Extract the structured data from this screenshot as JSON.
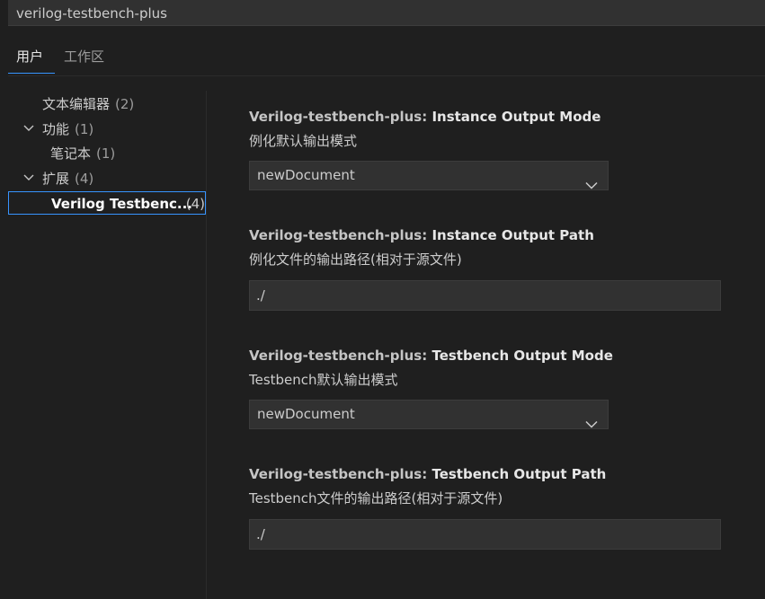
{
  "search": {
    "value": "verilog-testbench-plus"
  },
  "tabs": [
    {
      "label": "用户",
      "active": true
    },
    {
      "label": "工作区",
      "active": false
    }
  ],
  "tree": [
    {
      "label": "文本编辑器",
      "count": "(2)"
    },
    {
      "label": "功能",
      "count": "(1)",
      "expanded": true
    },
    {
      "label": "笔记本",
      "count": "(1)"
    },
    {
      "label": "扩展",
      "count": "(4)",
      "expanded": true
    },
    {
      "label": "Verilog Testbenc...",
      "count": "(4)",
      "selected": true
    }
  ],
  "settings": [
    {
      "prefix": "Verilog-testbench-plus: ",
      "name": "Instance Output Mode",
      "description": "例化默认输出模式",
      "value": "newDocument",
      "control": "select"
    },
    {
      "prefix": "Verilog-testbench-plus: ",
      "name": "Instance Output Path",
      "description": "例化文件的输出路径(相对于源文件)",
      "value": "./",
      "control": "text"
    },
    {
      "prefix": "Verilog-testbench-plus: ",
      "name": "Testbench Output Mode",
      "description": "Testbench默认输出模式",
      "value": "newDocument",
      "control": "select"
    },
    {
      "prefix": "Verilog-testbench-plus: ",
      "name": "Testbench Output Path",
      "description": "Testbench文件的输出路径(相对于源文件)",
      "value": "./",
      "control": "text"
    }
  ],
  "colors": {
    "accent": "#3794ff",
    "background": "#1f1f1f",
    "input_background": "#313131"
  }
}
